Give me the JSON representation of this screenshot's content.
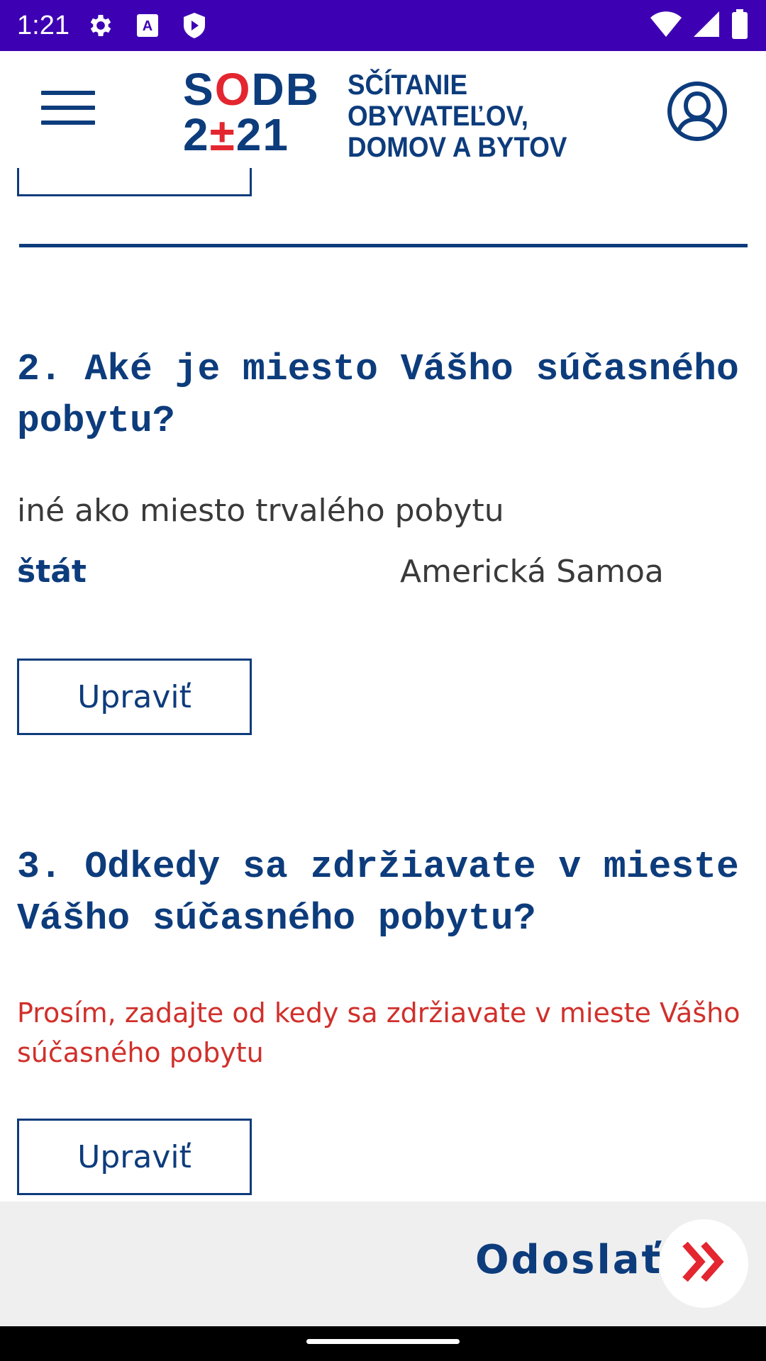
{
  "status_bar": {
    "time": "1:21",
    "icons": [
      "gear-icon",
      "text-a-icon",
      "shield-play-icon"
    ],
    "right_icons": [
      "wifi-icon",
      "signal-icon",
      "battery-icon"
    ],
    "bg_color": "#3d00b3"
  },
  "header": {
    "logo": {
      "line1_pre": "S",
      "line1_red": "O",
      "line1_post": "DB",
      "line2_pre": "2",
      "line2_red": "±",
      "line2_post": "21",
      "text_line1": "SČÍTANIE",
      "text_line2": "OBYVATEĽOV,",
      "text_line3": "DOMOV A BYTOV"
    }
  },
  "sections": {
    "q2": {
      "title": "2. Aké je miesto Vášho súčasného pobytu?",
      "answer": "iné ako miesto trvalého pobytu",
      "field_label": "štát",
      "field_value": "Americká Samoa",
      "edit_label": "Upraviť"
    },
    "q3": {
      "title": "3. Odkedy sa zdržiavate v mieste Vášho súčasného pobytu?",
      "error": "Prosím, zadajte od kedy sa zdržiavate v mieste Vášho súčasného pobytu",
      "edit_label": "Upraviť"
    }
  },
  "footer": {
    "submit_label": "Odoslať",
    "accent_color": "#e3262f"
  },
  "colors": {
    "brand_blue": "#0d3c7c",
    "error_red": "#d0302b"
  }
}
